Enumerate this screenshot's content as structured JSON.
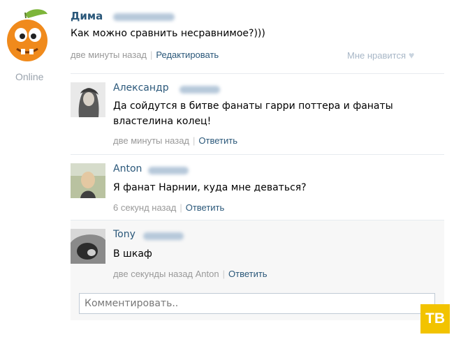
{
  "post": {
    "author_first_name": "Дима",
    "text": "Как можно сравнить несравнимое?)))",
    "time": "две минуты назад",
    "edit_label": "Редактировать",
    "like_label": "Мне нравится",
    "status": "Online"
  },
  "comments": [
    {
      "first_name": "Александр",
      "text": "Да сойдутся в битве фанаты гарри поттера и фанаты властелина колец!",
      "time": "две минуты назад",
      "reply_label": "Ответить"
    },
    {
      "first_name": "Anton",
      "text": "Я фанат Нарнии, куда мне деваться?",
      "time": "6 секунд назад",
      "reply_label": "Ответить"
    },
    {
      "first_name": "Tony",
      "text": "В шкаф",
      "time": "две секунды назад",
      "reply_to": "Anton",
      "reply_label": "Ответить"
    }
  ],
  "comment_box": {
    "placeholder": "Комментировать.."
  },
  "watermark": "ТВ",
  "icons": {
    "post_avatar": "orange-cartoon-avatar",
    "like": "heart-icon"
  }
}
